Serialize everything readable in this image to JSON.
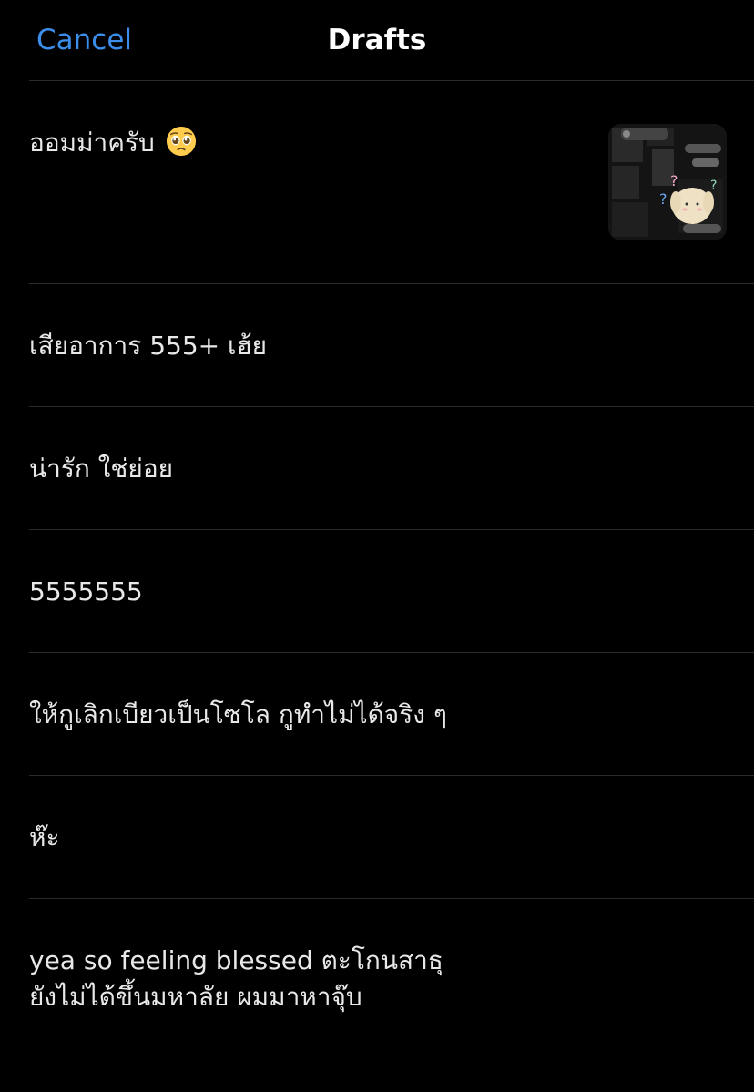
{
  "nav": {
    "cancel_label": "Cancel",
    "title": "Drafts"
  },
  "drafts": [
    {
      "text": "ออมม่าครับ",
      "has_emoji": true,
      "emoji_icon": "pleading-face-icon",
      "has_thumbnail": true,
      "thumbnail_icon": "draft-image-thumbnail"
    },
    {
      "text": "เสียอาการ 555+ เฮ้ย"
    },
    {
      "text": "น่ารัก ใช่ย่อย"
    },
    {
      "text": "5555555"
    },
    {
      "text": "ให้กูเลิกเบียวเป็นโซโล กูทำไม่ได้จริง ๆ"
    },
    {
      "text": "ห๊ะ"
    },
    {
      "text": "yea so feeling blessed ตะโกนสาธุ\nยังไม่ได้ขึ้นมหาลัย ผมมาหาจุ๊บ"
    }
  ],
  "colors": {
    "background": "#000000",
    "accent": "#3B8EEA",
    "text": "#E8E8E8",
    "divider": "#2A2A2A"
  }
}
